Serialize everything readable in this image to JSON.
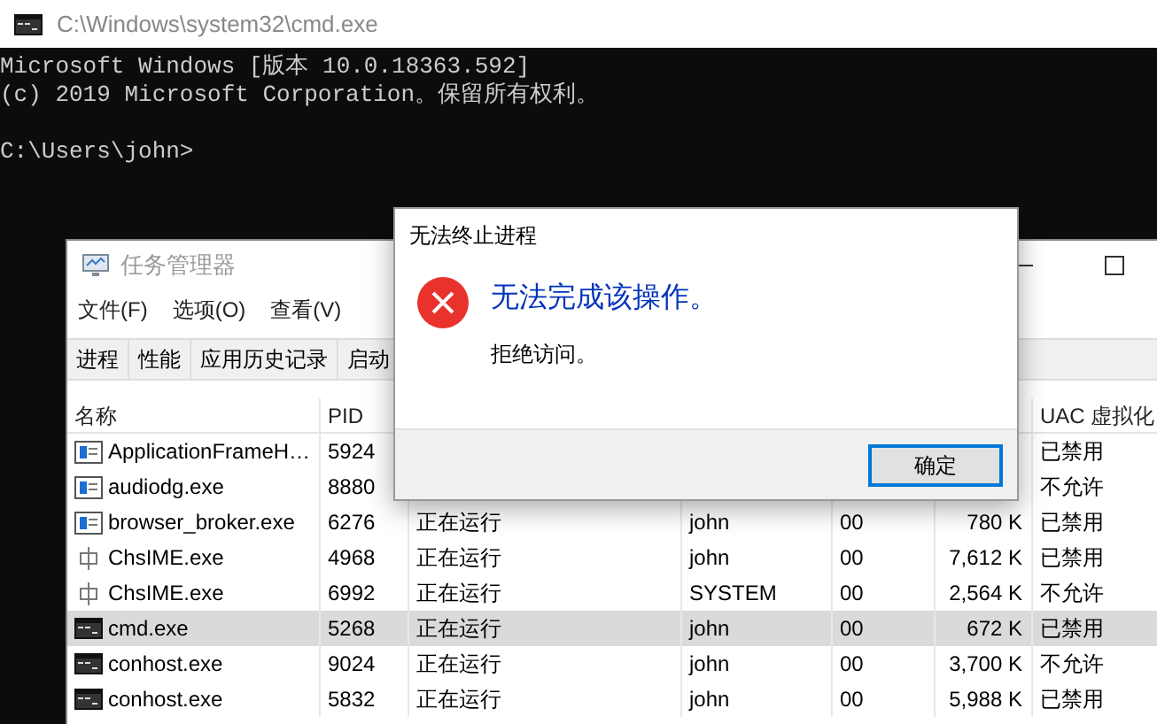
{
  "console_window": {
    "title": "C:\\Windows\\system32\\cmd.exe",
    "lines": [
      "Microsoft Windows [版本 10.0.18363.592]",
      "(c) 2019 Microsoft Corporation。保留所有权利。"
    ],
    "prompt": "C:\\Users\\john>"
  },
  "task_manager": {
    "title": "任务管理器",
    "menu": [
      "文件(F)",
      "选项(O)",
      "查看(V)"
    ],
    "tabs": [
      "进程",
      "性能",
      "应用历史记录",
      "启动"
    ],
    "columns": [
      "名称",
      "PID",
      null,
      null,
      null,
      null,
      "UAC 虚拟化"
    ],
    "rows": [
      {
        "kind": "window",
        "name": "ApplicationFrameH…",
        "pid": "5924",
        "status": null,
        "user": null,
        "cpu": null,
        "memory": null,
        "uac": "已禁用",
        "selected": false
      },
      {
        "kind": "window",
        "name": "audiodg.exe",
        "pid": "8880",
        "status": null,
        "user": null,
        "cpu": null,
        "memory": null,
        "uac": "不允许",
        "selected": false
      },
      {
        "kind": "window",
        "name": "browser_broker.exe",
        "pid": "6276",
        "status": "正在运行",
        "user": "john",
        "cpu": "00",
        "memory": "780 K",
        "uac": "已禁用",
        "selected": false
      },
      {
        "kind": "ime",
        "name": "ChsIME.exe",
        "pid": "4968",
        "status": "正在运行",
        "user": "john",
        "cpu": "00",
        "memory": "7,612 K",
        "uac": "已禁用",
        "selected": false
      },
      {
        "kind": "ime",
        "name": "ChsIME.exe",
        "pid": "6992",
        "status": "正在运行",
        "user": "SYSTEM",
        "cpu": "00",
        "memory": "2,564 K",
        "uac": "不允许",
        "selected": false
      },
      {
        "kind": "console",
        "name": "cmd.exe",
        "pid": "5268",
        "status": "正在运行",
        "user": "john",
        "cpu": "00",
        "memory": "672 K",
        "uac": "已禁用",
        "selected": true
      },
      {
        "kind": "console",
        "name": "conhost.exe",
        "pid": "9024",
        "status": "正在运行",
        "user": "john",
        "cpu": "00",
        "memory": "3,700 K",
        "uac": "不允许",
        "selected": false
      },
      {
        "kind": "console",
        "name": "conhost.exe",
        "pid": "5832",
        "status": "正在运行",
        "user": "john",
        "cpu": "00",
        "memory": "5,988 K",
        "uac": "已禁用",
        "selected": false
      }
    ]
  },
  "dialog": {
    "title": "无法终止进程",
    "heading": "无法完成该操作。",
    "message": "拒绝访问。",
    "button": "确定"
  }
}
